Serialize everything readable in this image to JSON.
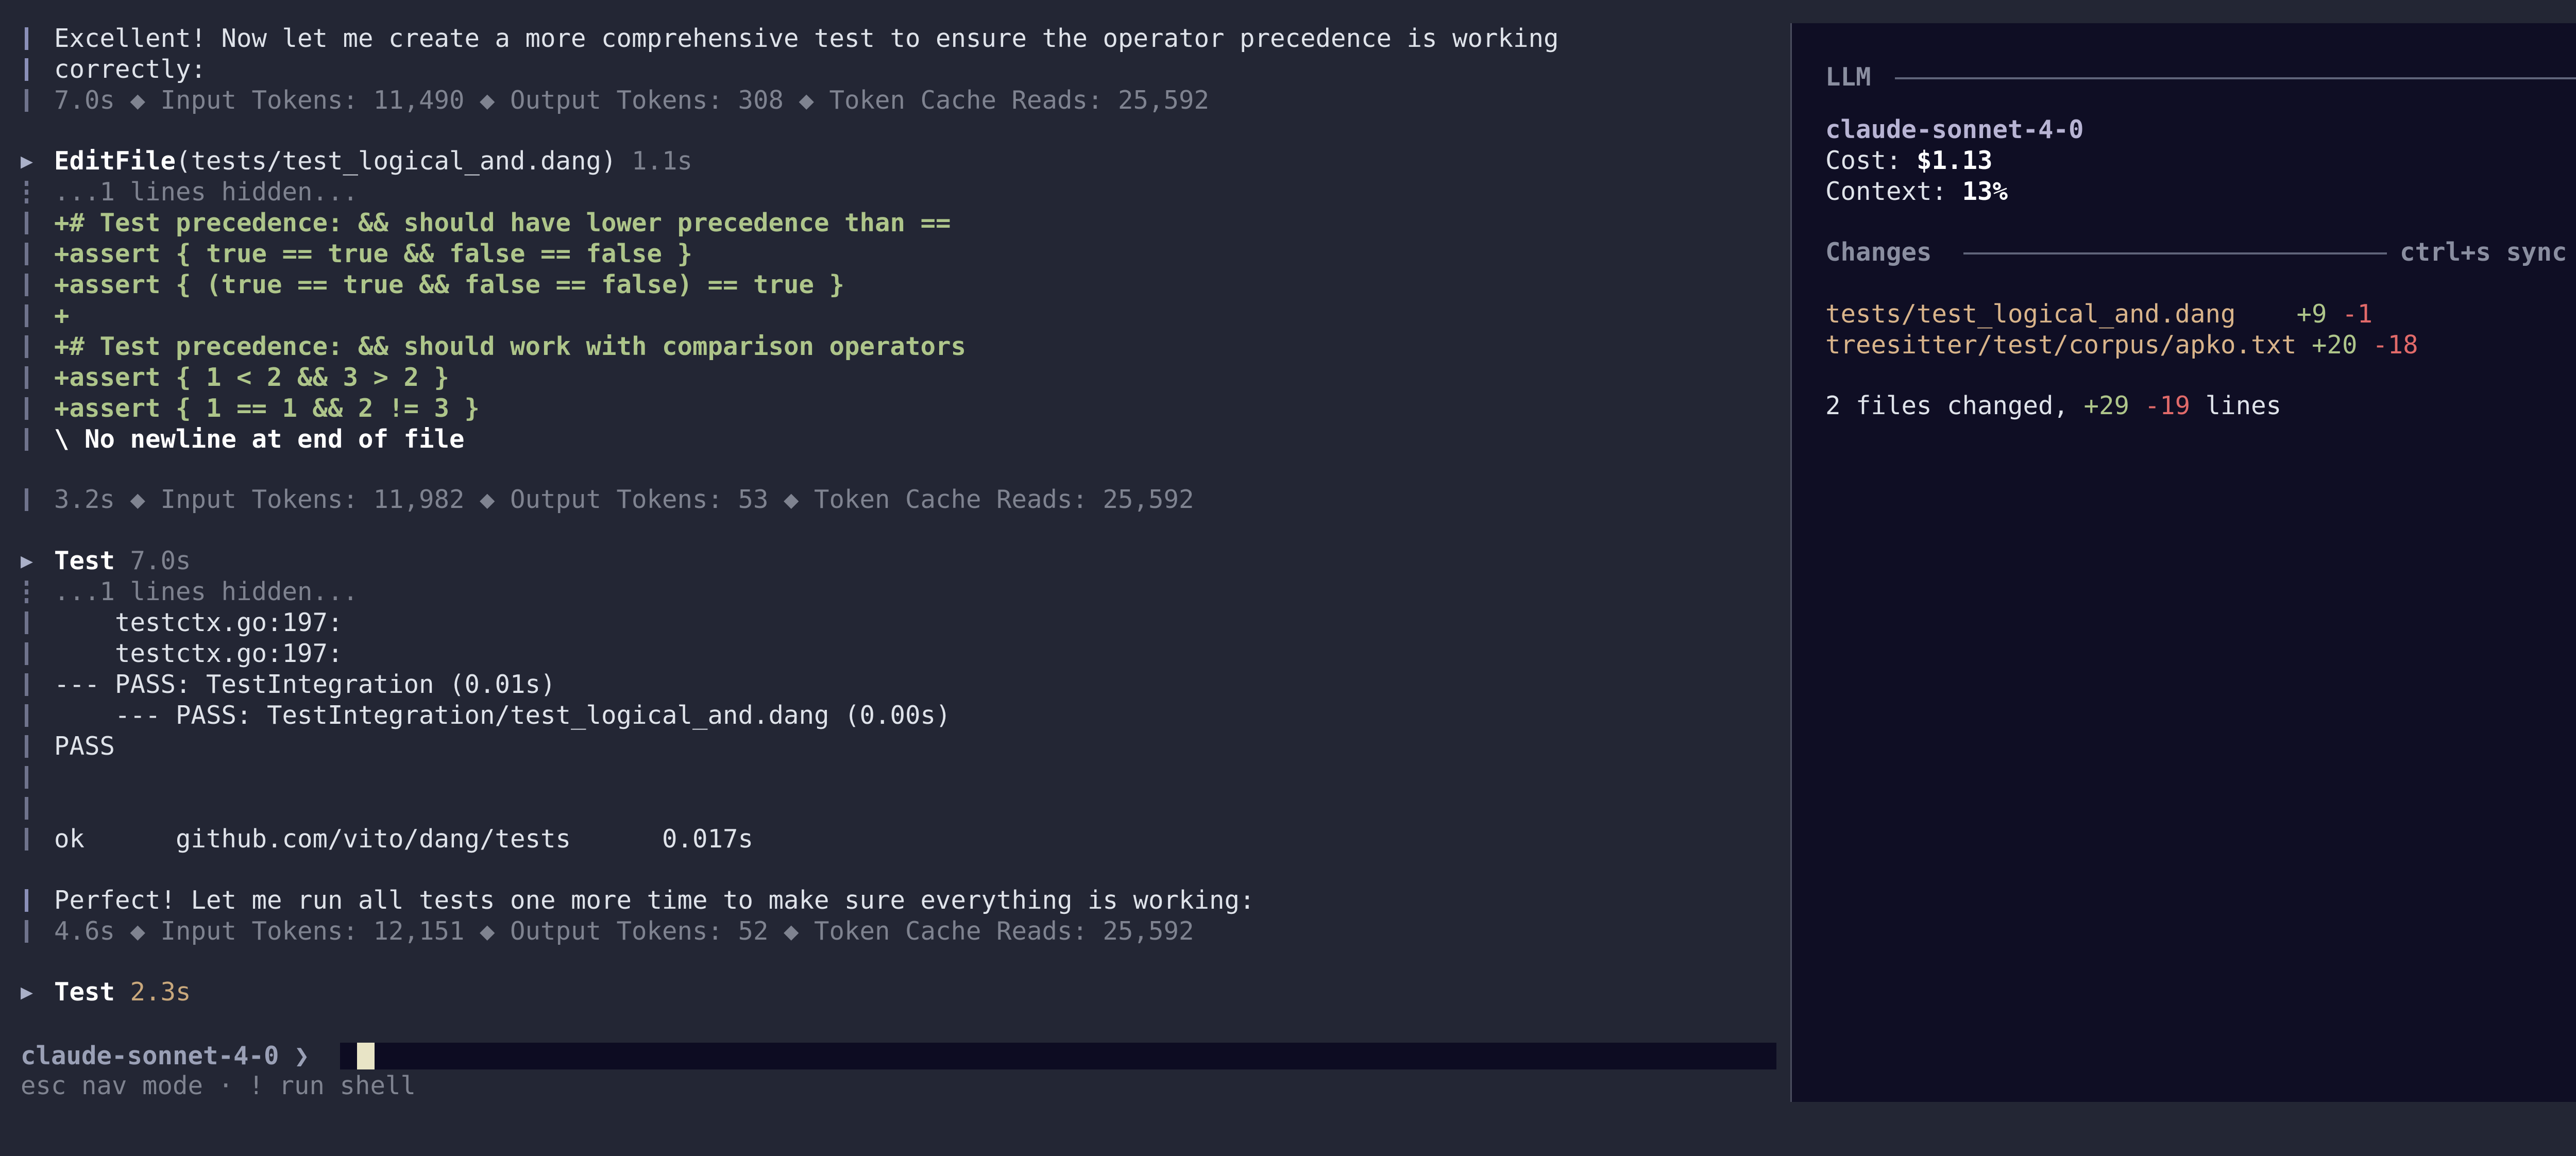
{
  "conversation": {
    "msg1": {
      "text": "Excellent! Now let me create a more comprehensive test to ensure the operator precedence is working",
      "text2": "correctly:",
      "meta": "7.0s ◆ Input Tokens: 11,490 ◆ Output Tokens: 308 ◆ Token Cache Reads: 25,592"
    },
    "edit": {
      "tool": "EditFile",
      "args": "(tests/test_logical_and.dang)",
      "duration": "1.1s",
      "hidden": "...1 lines hidden...",
      "lines": [
        "+# Test precedence: && should have lower precedence than ==",
        "+assert { true == true && false == false }",
        "+assert { (true == true && false == false) == true }",
        "+",
        "+# Test precedence: && should work with comparison operators",
        "+assert { 1 < 2 && 3 > 2 }",
        "+assert { 1 == 1 && 2 != 3 }"
      ],
      "nonewline": "\\ No newline at end of file"
    },
    "meta2": "3.2s ◆ Input Tokens: 11,982 ◆ Output Tokens: 53 ◆ Token Cache Reads: 25,592",
    "test1": {
      "tool": "Test",
      "duration": "7.0s",
      "hidden": "...1 lines hidden...",
      "lines": [
        "    testctx.go:197:",
        "    testctx.go:197:",
        "--- PASS: TestIntegration (0.01s)",
        "    --- PASS: TestIntegration/test_logical_and.dang (0.00s)",
        "PASS",
        "",
        "",
        "ok      github.com/vito/dang/tests      0.017s"
      ]
    },
    "msg2": {
      "text": "Perfect! Let me run all tests one more time to make sure everything is working:",
      "meta": "4.6s ◆ Input Tokens: 12,151 ◆ Output Tokens: 52 ◆ Token Cache Reads: 25,592"
    },
    "test2": {
      "tool": "Test",
      "duration": "2.3s"
    }
  },
  "prompt": {
    "model": "claude-sonnet-4-0",
    "chevron": "❯",
    "hint": "esc nav mode · ! run shell"
  },
  "panel": {
    "llm_header": "LLM",
    "model": "claude-sonnet-4-0",
    "cost_label": "Cost:",
    "cost_value": "$1.13",
    "context_label": "Context:",
    "context_value": "13%",
    "changes_header": "Changes",
    "sync_shortcut": "ctrl+s sync",
    "files": [
      {
        "path": "tests/test_logical_and.dang",
        "added": "+9",
        "removed": "-1"
      },
      {
        "path": "treesitter/test/corpus/apko.txt",
        "added": "+20",
        "removed": "-18"
      }
    ],
    "summary_prefix": "2 files changed,",
    "summary_added": "+29",
    "summary_removed": "-19",
    "summary_suffix": "lines"
  }
}
